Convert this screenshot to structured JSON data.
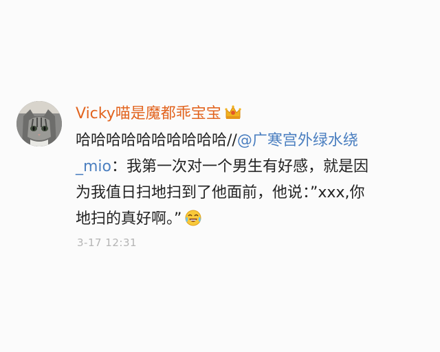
{
  "post": {
    "username": "Vicky喵是魔都乖宝宝",
    "badge_icon": "crown-icon",
    "text_line1_prefix": "哈哈哈哈哈哈哈哈哈哈//",
    "mention_part1": "@广寒宫外绿水绕",
    "mention_part2": "_mio",
    "text_line2_rest": "：我第一次对一个男生有好感，就是因",
    "text_line3": "为我值日扫地扫到了他面前，他说：”xxx,你",
    "text_line4": "地扫的真好啊。”",
    "emoji_icon": "laughing-crying-emoji-icon",
    "timestamp": "3-17 12:31"
  },
  "colors": {
    "username": "#e2641f",
    "mention": "#4b7fc0",
    "text": "#222222",
    "timestamp": "#b4b4b4",
    "background": "#fbfbfb"
  }
}
